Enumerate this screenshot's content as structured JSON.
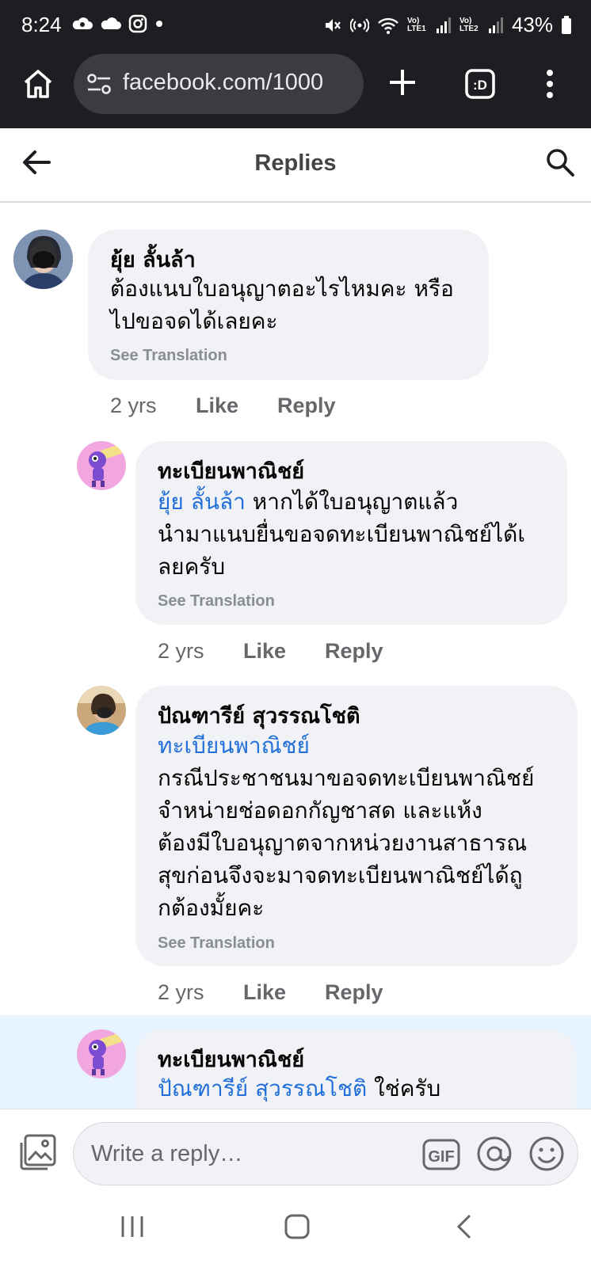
{
  "status_bar": {
    "time": "8:24",
    "battery": "43%",
    "signal1": "Vo) LTE1",
    "signal2": "Vo) LTE2"
  },
  "browser": {
    "url": "facebook.com/1000"
  },
  "header": {
    "title": "Replies"
  },
  "comments": [
    {
      "author": "ยุ้ย ลั้นล้า",
      "mention": "",
      "lines": [
        "ต้องแนบใบอนุญาตอะไรไหมคะ หรือ",
        "ไปขอจดได้เลยคะ"
      ],
      "see_translation": "See Translation",
      "time": "2 yrs",
      "like": "Like",
      "reply": "Reply"
    },
    {
      "author": "ทะเบียนพาณิชย์",
      "mention": "ยุ้ย ลั้นล้า",
      "lines": [
        " หากได้ใบอนุญาตแล้ว",
        "นำมาแนบยื่นขอจดทะเบียนพาณิชย์ได้เ",
        "ลยครับ"
      ],
      "see_translation": "See Translation",
      "time": "2 yrs",
      "like": "Like",
      "reply": "Reply"
    },
    {
      "author": "ปัณฑารีย์ สุวรรณโชติ",
      "mention": "ทะเบียนพาณิชย์",
      "lines": [
        "กรณีประชาชนมาขอจดทะเบียนพาณิชย์",
        "จำหน่ายช่อดอกกัญชาสด และแห้ง",
        "ต้องมีใบอนุญาตจากหน่วยงานสาธารณ",
        "สุขก่อนจึงจะมาจดทะเบียนพาณิชย์ได้ถู",
        "กต้องมั้ยคะ"
      ],
      "see_translation": "See Translation",
      "time": "2 yrs",
      "like": "Like",
      "reply": "Reply"
    },
    {
      "author": "ทะเบียนพาณิชย์",
      "mention": "ปัณฑารีย์ สุวรรณโชติ",
      "lines": [
        " ใช่ครับ"
      ]
    }
  ],
  "composer": {
    "placeholder": "Write a reply…",
    "gif_label": "GIF"
  }
}
